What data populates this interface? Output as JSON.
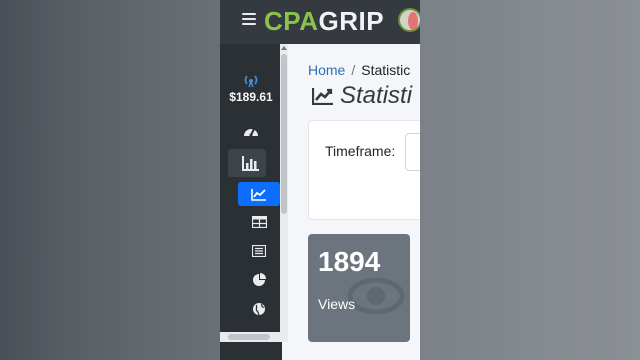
{
  "app": {
    "logo_cpa": "CPA",
    "logo_grip": "GRIP"
  },
  "sidebar": {
    "balance": "$189.61",
    "items": [
      {
        "icon": "gauge-icon"
      },
      {
        "icon": "bar-chart-icon"
      },
      {
        "icon": "line-chart-icon"
      },
      {
        "icon": "table-icon"
      },
      {
        "icon": "list-icon"
      },
      {
        "icon": "pie-chart-icon"
      },
      {
        "icon": "globe-icon"
      }
    ]
  },
  "breadcrumb": {
    "home": "Home",
    "separator": "/",
    "current": "Statistic"
  },
  "page": {
    "title": "Statisti"
  },
  "filters": {
    "timeframe_label": "Timeframe:"
  },
  "stats": {
    "views_value": "1894",
    "views_label": "Views"
  },
  "colors": {
    "topbar": "#343a40",
    "sidebar": "#2b3035",
    "active": "#0d6efd",
    "logo_cpa": "#8bc34a",
    "views_box": "#6c757d"
  }
}
